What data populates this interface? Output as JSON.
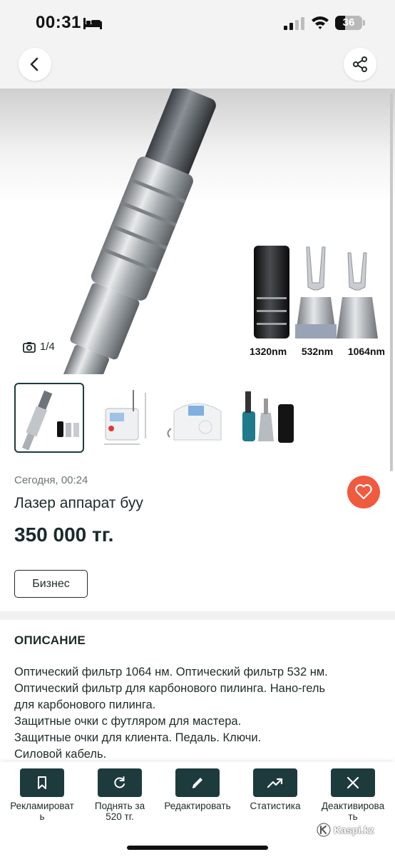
{
  "status_bar": {
    "time": "00:31",
    "battery_level": "36",
    "battery_fraction": 0.36,
    "icons": [
      "bed-icon",
      "signal-icon",
      "wifi-icon",
      "battery-icon"
    ]
  },
  "nav": {
    "back_icon": "chevron-left-icon",
    "share_icon": "share-icon"
  },
  "gallery": {
    "counter_icon": "camera-icon",
    "counter": "1/4",
    "wavelengths": [
      "1320nm",
      "532nm",
      "1064nm"
    ],
    "active_index": 0,
    "thumbnail_count": 4
  },
  "listing": {
    "date": "Сегодня, 00:24",
    "title": "Лазер аппарат буу",
    "price": "350 000 тг.",
    "tag": "Бизнес",
    "favorite_icon": "heart-icon"
  },
  "description": {
    "heading": "ОПИСАНИЕ",
    "lines": [
      "Оптический фильтр 1064 нм. Оптический фильтр 532 нм.",
      "Оптический фильтр для карбонового пилинга. Нано-гель",
      "для карбонового пилинга.",
      "Защитные очки с футляром для мастера.",
      "Защитные очки для клиента. Педаль. Ключи.",
      "Силовой кабель."
    ]
  },
  "actions": [
    {
      "label": "Рекламироват\nь",
      "icon": "bookmark-icon"
    },
    {
      "label": "Поднять за\n520 тг.",
      "icon": "refresh-icon"
    },
    {
      "label": "Редактировать",
      "icon": "pencil-icon"
    },
    {
      "label": "Статистика",
      "icon": "trend-up-icon"
    },
    {
      "label": "Деактивирова\nть",
      "icon": "close-icon"
    }
  ],
  "watermark": {
    "text": "Kaspi.kz"
  },
  "colors": {
    "accent_dark": "#1d3b3d",
    "favorite": "#f05a3e",
    "text": "#1e2a2a"
  }
}
